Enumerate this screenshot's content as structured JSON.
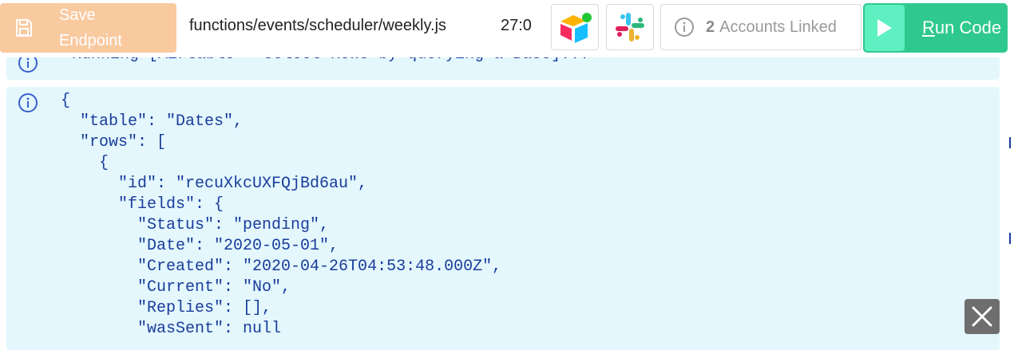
{
  "toolbar": {
    "save_label": "Save Endpoint",
    "file_path": "functions/events/scheduler/weekly.js",
    "cursor_position": "27:0",
    "integrations": [
      {
        "name": "airtable-icon"
      },
      {
        "name": "slack-icon"
      }
    ],
    "accounts": {
      "count": "2",
      "label": "Accounts Linked"
    },
    "run_label_first": "R",
    "run_label_rest": "un Code"
  },
  "console": {
    "running_message": "Running [Airtable → Select Rows by querying a Base]...",
    "output_lines": [
      "{",
      "  \"table\": \"Dates\",",
      "  \"rows\": [",
      "    {",
      "      \"id\": \"recuXkcUXFQjBd6au\",",
      "      \"fields\": {",
      "        \"Status\": \"pending\",",
      "        \"Date\": \"2020-05-01\",",
      "        \"Created\": \"2020-04-26T04:53:48.000Z\",",
      "        \"Current\": \"No\",",
      "        \"Replies\": [],",
      "        \"wasSent\": null"
    ]
  },
  "colors": {
    "save_button": "#f9c9a0",
    "run_button": "#2fc98d",
    "run_play": "#5ef0c1",
    "log_background": "#e3f7fd",
    "log_text": "#1a3d9b",
    "close_button": "#6e6e6e"
  }
}
